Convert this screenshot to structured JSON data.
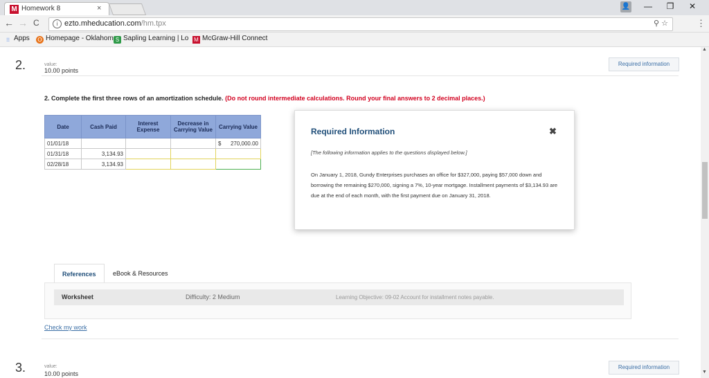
{
  "browser": {
    "tab_logo": "M",
    "tab_title": "Homework 8",
    "tab_close": "×",
    "profile_icon": "👤",
    "win_min": "—",
    "win_restore": "❐",
    "win_close": "✕",
    "back": "←",
    "forward": "→",
    "reload": "C",
    "url_host": "ezto.mheducation.com",
    "url_path": "/hm.tpx",
    "zoom_icon": "⚲",
    "star_icon": "☆",
    "menu": "⋮"
  },
  "bookmarks": [
    {
      "icon": "⁝⁝",
      "label": "Apps"
    },
    {
      "icon": "O",
      "label": "Homepage - Oklahom",
      "color": "#e8741c"
    },
    {
      "icon": "S",
      "label": "Sapling Learning | Lo",
      "color": "#2e9a48"
    },
    {
      "icon": "M",
      "label": "McGraw-Hill Connect",
      "color": "#c8102e"
    }
  ],
  "question2": {
    "number": "2.",
    "value_label": "value:",
    "points": "10.00 points",
    "required_btn": "Required information",
    "instruction": "2. Complete the first three rows of an amortization schedule.",
    "instruction_red": "(Do not round intermediate calculations. Round your final answers to 2 decimal places.)"
  },
  "table": {
    "headers": [
      "Date",
      "Cash Paid",
      "Interest Expense",
      "Decrease in Carrying Value",
      "Carrying Value"
    ],
    "rows": [
      {
        "date": "01/01/18",
        "cash": "",
        "carrying_prefix": "$",
        "carrying": "270,000.00"
      },
      {
        "date": "01/31/18",
        "cash": "3,134.93"
      },
      {
        "date": "02/28/18",
        "cash": "3,134.93"
      }
    ]
  },
  "popup": {
    "title": "Required Information",
    "close": "✖",
    "subtitle": "[The following information applies to the questions displayed below.]",
    "body": "On January 1, 2018, Gundy Enterprises purchases an office for $327,000, paying $57,000 down and borrowing the remaining $270,000, signing a 7%, 10-year mortgage. Installment payments of $3,134.93 are due at the end of each month, with the first payment due on January 31, 2018."
  },
  "references": {
    "tab_refs": "References",
    "tab_ebook": "eBook & Resources",
    "worksheet": "Worksheet",
    "difficulty": "Difficulty: 2 Medium",
    "objective": "Learning Objective: 09-02 Account for installment notes payable."
  },
  "check_work": "Check my work",
  "question3": {
    "number": "3.",
    "value_label": "value:",
    "points": "10.00 points",
    "required_btn": "Required information"
  },
  "scroll_up": "▲",
  "scroll_down": "▼"
}
